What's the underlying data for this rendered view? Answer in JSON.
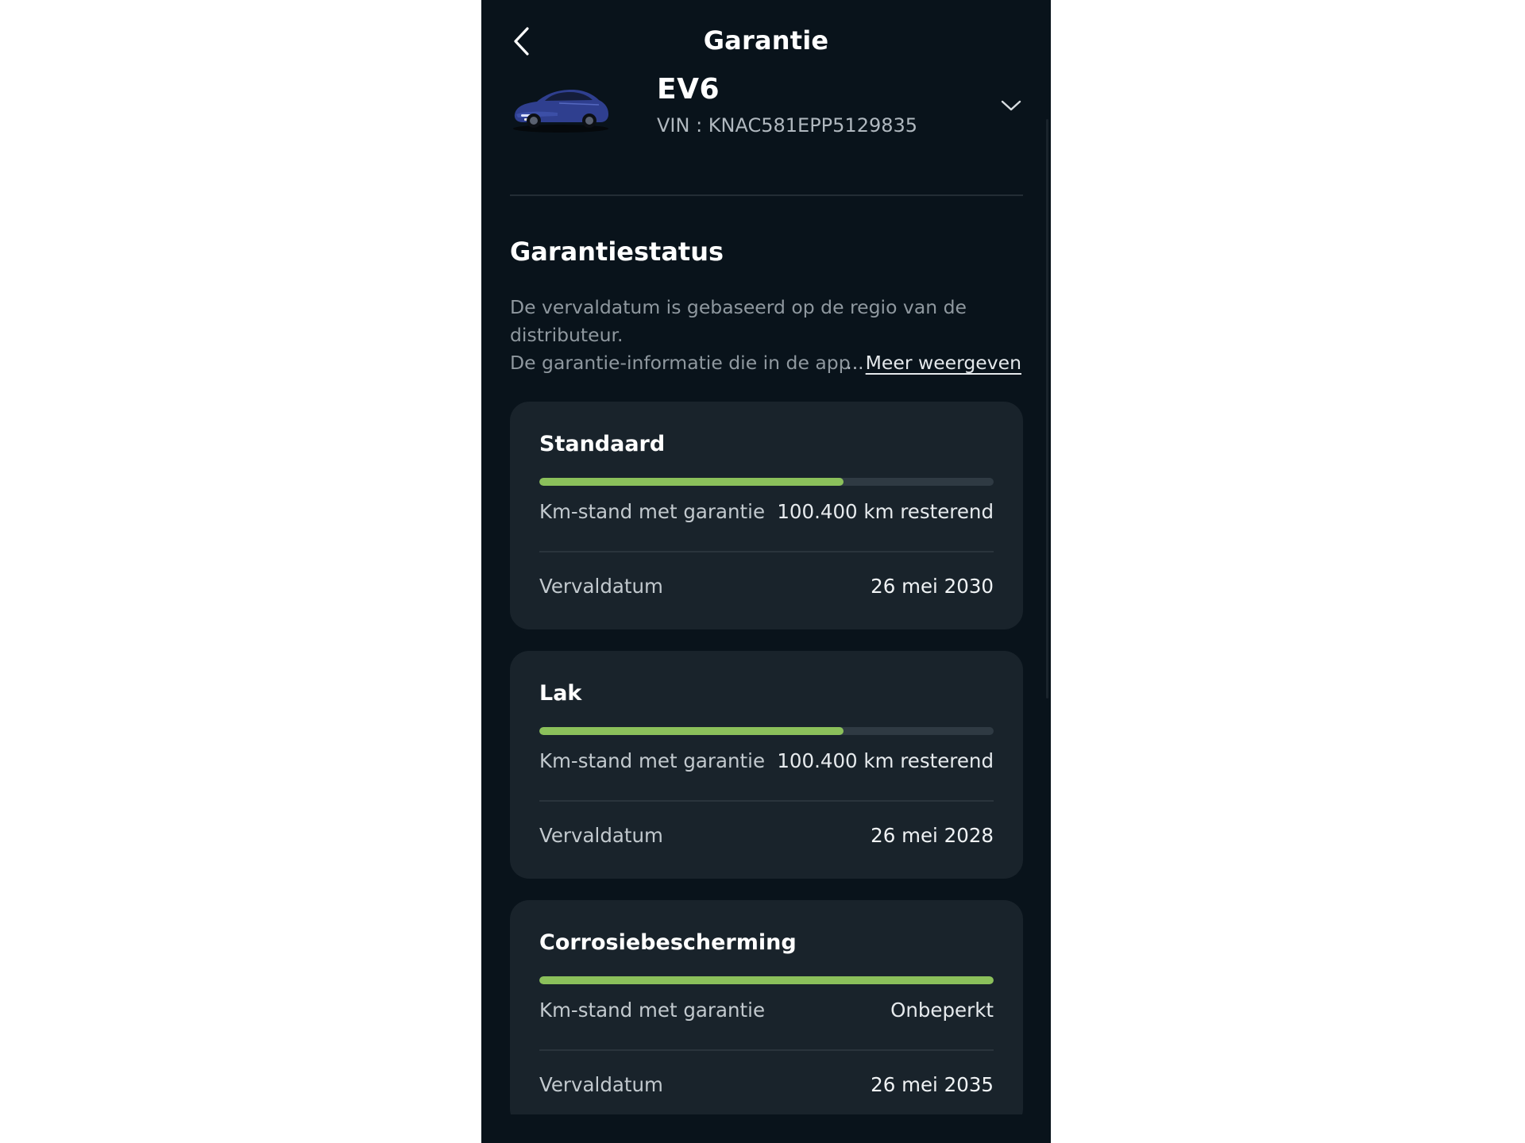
{
  "header": {
    "title": "Garantie"
  },
  "vehicle": {
    "name": "EV6",
    "vin": "VIN : KNAC581EPP5129835"
  },
  "section": {
    "title": "Garantiestatus",
    "description_line1": "De vervaldatum is gebaseerd op de regio van de",
    "description_line2": "distributeur.",
    "description_line3": "De garantie-informatie die in de app",
    "more_ellipsis": "...",
    "more_label": "Meer weergeven"
  },
  "warranties": [
    {
      "title": "Standaard",
      "progress_fraction": 0.67,
      "km_label": "Km-stand met garantie",
      "km_value": "100.400 km resterend",
      "date_label": "Vervaldatum",
      "date_value": "26 mei 2030"
    },
    {
      "title": "Lak",
      "progress_fraction": 0.67,
      "km_label": "Km-stand met garantie",
      "km_value": "100.400 km resterend",
      "date_label": "Vervaldatum",
      "date_value": "26 mei 2028"
    },
    {
      "title": "Corrosiebescherming",
      "progress_fraction": 1.0,
      "km_label": "Km-stand met garantie",
      "km_value": "Onbeperkt",
      "date_label": "Vervaldatum",
      "date_value": "26 mei 2035"
    }
  ],
  "colors": {
    "background": "#09131b",
    "card": "#19232b",
    "progress_fill": "#8bc05b",
    "progress_track": "#2f3a43"
  },
  "icons": {
    "back": "chevron-left-icon",
    "vehicle_selector": "chevron-down-icon",
    "vehicle_image": "car-icon"
  }
}
